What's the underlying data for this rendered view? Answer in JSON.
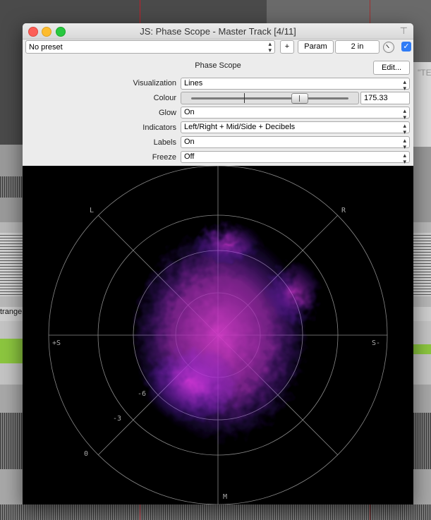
{
  "window": {
    "title": "JS: Phase Scope - Master Track [4/11]"
  },
  "toolbar": {
    "preset_value": "No preset",
    "add_label": "+",
    "param_label": "Param",
    "io_label": "2 in",
    "enabled": true
  },
  "plugin": {
    "name": "Phase Scope",
    "edit_label": "Edit..."
  },
  "params": {
    "visualization": {
      "label": "Visualization",
      "value": "Lines"
    },
    "colour": {
      "label": "Colour",
      "value": "175.33"
    },
    "glow": {
      "label": "Glow",
      "value": "On"
    },
    "indicators": {
      "label": "Indicators",
      "value": "Left/Right + Mid/Side + Decibels"
    },
    "labels": {
      "label": "Labels",
      "value": "On"
    },
    "freeze": {
      "label": "Freeze",
      "value": "Off"
    }
  },
  "scope": {
    "left": "L",
    "right": "R",
    "plus_side": "+S",
    "minus_side": "S-",
    "mid": "M",
    "db_marks": [
      "-6",
      "-3",
      "0"
    ]
  },
  "background": {
    "track_label": "trange",
    "ghost_text": "\"TE"
  }
}
